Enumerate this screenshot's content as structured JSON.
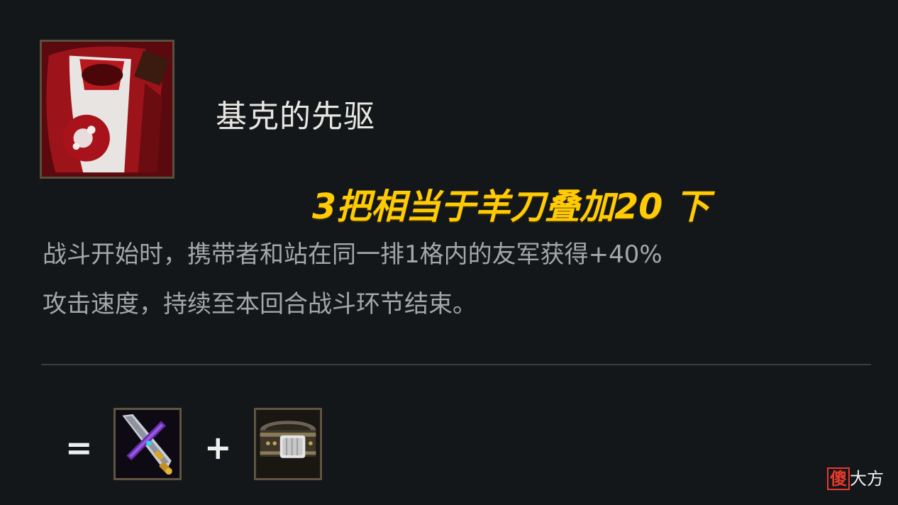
{
  "item": {
    "name": "基克的先驱",
    "icon": "zekes-herald-icon"
  },
  "overlay_note": "3把相当于羊刀叠加20 下",
  "description": {
    "line1": "战斗开始时，携带者和站在同一排1格内的友军获得+40%",
    "line2": "攻击速度，持续至本回合战斗环节结束。"
  },
  "recipe": {
    "equals": "=",
    "plus": "+",
    "components": [
      {
        "icon": "recurve-bow-icon"
      },
      {
        "icon": "giants-belt-icon"
      }
    ]
  },
  "watermark": {
    "part1": "傻",
    "part2": "大方"
  },
  "colors": {
    "background": "#13171a",
    "highlight": "#ffcb05",
    "description_text": "#a4a7a6",
    "frame": "#5a4f3c"
  }
}
